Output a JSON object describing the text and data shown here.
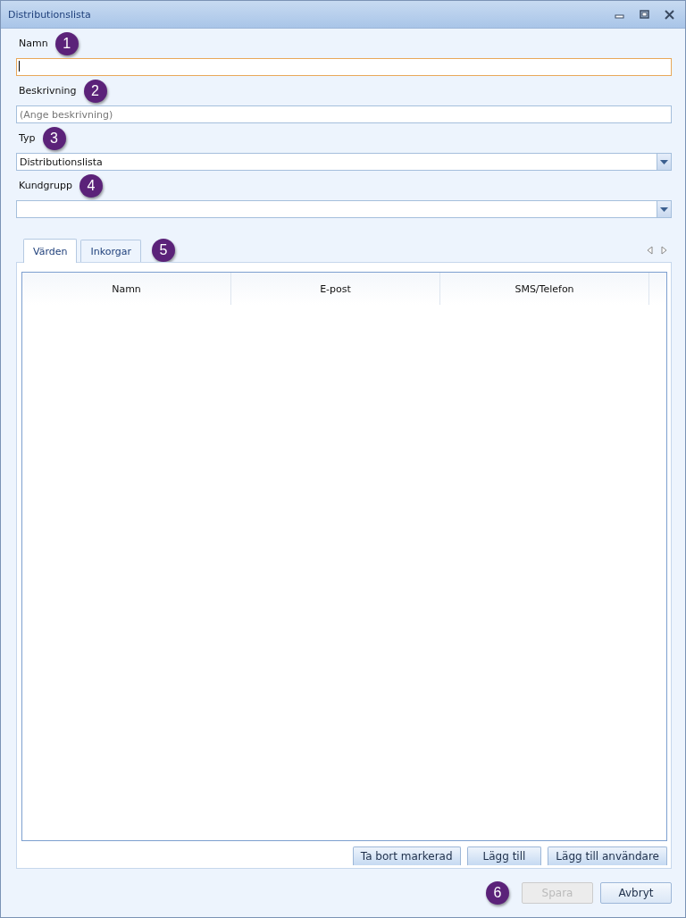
{
  "window": {
    "title": "Distributionslista"
  },
  "fields": [
    {
      "label": "Namn",
      "callout": "1",
      "kind": "text",
      "focused": true
    },
    {
      "label": "Beskrivning",
      "callout": "2",
      "kind": "text",
      "placeholder": "(Ange beskrivning)",
      "focused": false
    },
    {
      "label": "Typ",
      "callout": "3",
      "kind": "dropdown",
      "value": "Distributionslista",
      "focused": false
    },
    {
      "label": "Kundgrupp",
      "callout": "4",
      "kind": "dropdown",
      "focused": false
    }
  ],
  "tabs": [
    {
      "label": "Värden",
      "selected": true
    },
    {
      "label": "Inkorgar",
      "selected": false
    }
  ],
  "tabs_callout": "5",
  "table": {
    "columns": [
      "Namn",
      "E-post",
      "SMS/Telefon"
    ]
  },
  "table_buttons": [
    "Ta bort markerad",
    "Lägg till",
    "Lägg till användare"
  ],
  "footer": {
    "callout": "6",
    "buttons": [
      {
        "label": "Spara",
        "disabled": true
      },
      {
        "label": "Avbryt",
        "disabled": false
      }
    ]
  }
}
